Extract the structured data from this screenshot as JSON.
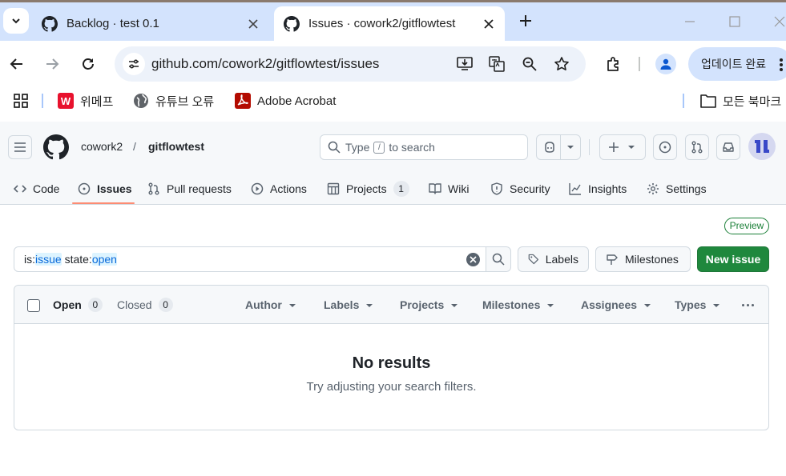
{
  "browser": {
    "tabs": [
      {
        "title": "Backlog · test 0.1",
        "active": false
      },
      {
        "title": "Issues · cowork2/gitflowtest",
        "active": true
      }
    ],
    "url": "github.com/cowork2/gitflowtest/issues",
    "update_button": "업데이트 완료",
    "bookmarks": [
      {
        "label": "위메프",
        "icon": "wemakeprice-icon"
      },
      {
        "label": "유튜브 오류",
        "icon": "globe-icon"
      },
      {
        "label": "Adobe Acrobat",
        "icon": "acrobat-icon"
      }
    ],
    "all_bookmarks": "모든 북마크"
  },
  "github": {
    "owner": "cowork2",
    "separator": "/",
    "repo": "gitflowtest",
    "search": {
      "prefix": "Type",
      "key": "/",
      "suffix": "to search"
    },
    "repo_nav": [
      {
        "label": "Code",
        "icon": "code-icon"
      },
      {
        "label": "Issues",
        "icon": "issue-icon",
        "active": true
      },
      {
        "label": "Pull requests",
        "icon": "pull-request-icon"
      },
      {
        "label": "Actions",
        "icon": "play-icon"
      },
      {
        "label": "Projects",
        "icon": "table-icon",
        "count": "1"
      },
      {
        "label": "Wiki",
        "icon": "book-icon"
      },
      {
        "label": "Security",
        "icon": "shield-icon"
      },
      {
        "label": "Insights",
        "icon": "graph-icon"
      },
      {
        "label": "Settings",
        "icon": "gear-icon"
      }
    ]
  },
  "issues": {
    "preview_badge": "Preview",
    "query": {
      "k1": "is:",
      "v1": "issue",
      "sp": " ",
      "k2": "state:",
      "v2": "open"
    },
    "labels_button": "Labels",
    "milestones_button": "Milestones",
    "new_issue_button": "New issue",
    "open_label": "Open",
    "open_count": "0",
    "closed_label": "Closed",
    "closed_count": "0",
    "filters": [
      "Author",
      "Labels",
      "Projects",
      "Milestones",
      "Assignees",
      "Types"
    ],
    "empty_title": "No results",
    "empty_subtitle": "Try adjusting your search filters."
  },
  "colors": {
    "primary_button": "#1f883d",
    "active_tab_underline": "#fd8c73",
    "query_value": "#0969da",
    "chrome_frame": "#d3e3fd"
  }
}
